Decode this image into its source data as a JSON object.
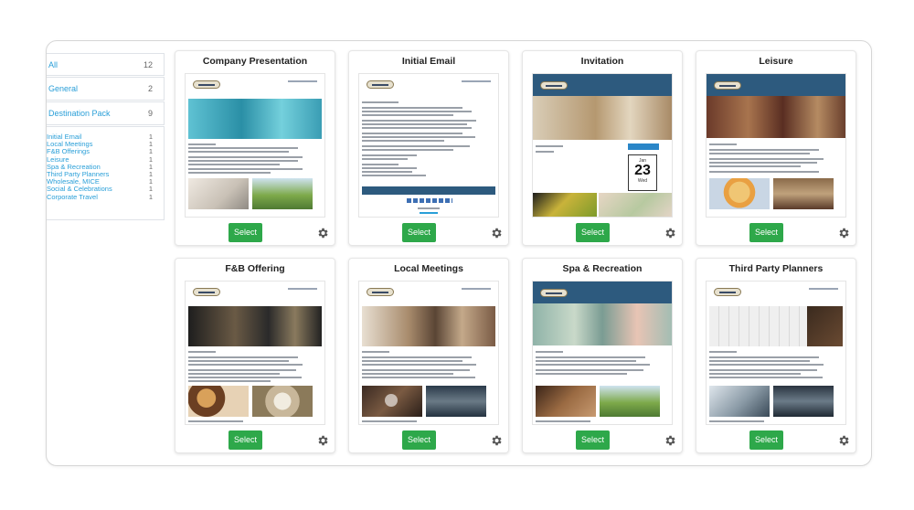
{
  "sidebar": {
    "summary_rows": [
      {
        "label": "All",
        "count": "12"
      },
      {
        "label": "General",
        "count": "2"
      },
      {
        "label": "Destination Pack",
        "count": "9"
      }
    ],
    "items": [
      {
        "label": "Initial Email",
        "count": "1"
      },
      {
        "label": "Local Meetings",
        "count": "1"
      },
      {
        "label": "F&B Offerings",
        "count": "1"
      },
      {
        "label": "Leisure",
        "count": "1"
      },
      {
        "label": "Spa & Recreation",
        "count": "1"
      },
      {
        "label": "Third Party Planners",
        "count": "1"
      },
      {
        "label": "Wholesale, MICE",
        "count": "1"
      },
      {
        "label": "Social & Celebrations",
        "count": "1"
      },
      {
        "label": "Corporate Travel",
        "count": "1"
      }
    ]
  },
  "cards": [
    {
      "title": "Company Presentation",
      "button": "Select",
      "gear": "gear-icon"
    },
    {
      "title": "Initial Email",
      "button": "Select",
      "gear": "gear-icon"
    },
    {
      "title": "Invitation",
      "button": "Select",
      "gear": "gear-icon",
      "calendar": {
        "month": "Jan",
        "day": "23",
        "weekday": "Wed"
      }
    },
    {
      "title": "Leisure",
      "button": "Select",
      "gear": "gear-icon"
    },
    {
      "title": "F&B Offering",
      "button": "Select",
      "gear": "gear-icon"
    },
    {
      "title": "Local Meetings",
      "button": "Select",
      "gear": "gear-icon"
    },
    {
      "title": "Spa & Recreation",
      "button": "Select",
      "gear": "gear-icon"
    },
    {
      "title": "Third Party Planners",
      "button": "Select",
      "gear": "gear-icon"
    }
  ],
  "colors": {
    "select_button": "#2ea84a",
    "link": "#2a9fd8",
    "accent_header": "#2d5a7e"
  }
}
